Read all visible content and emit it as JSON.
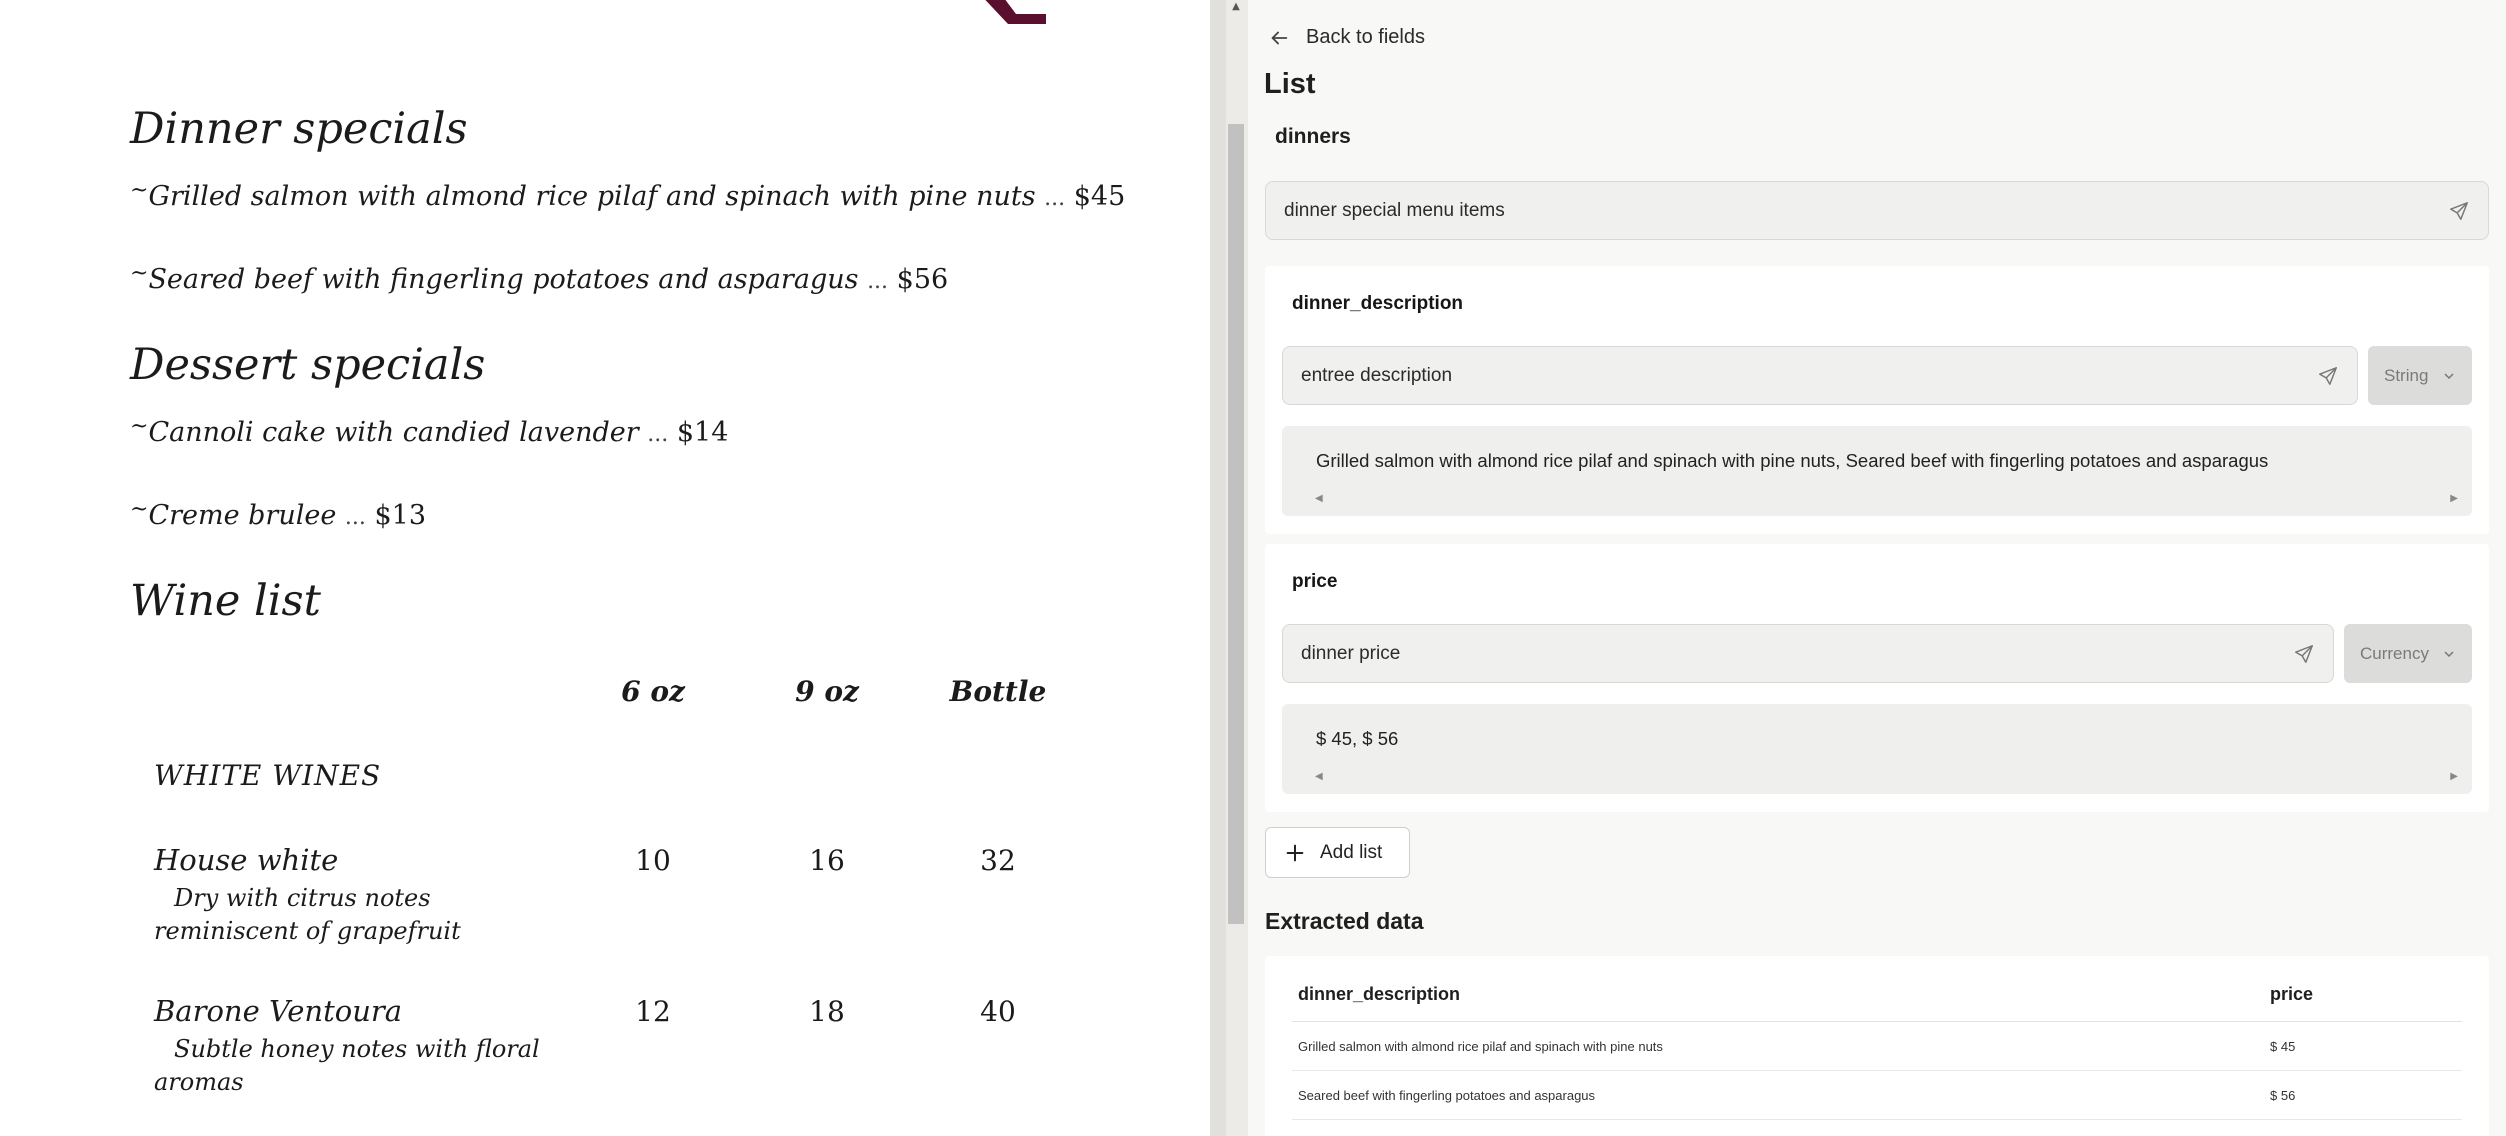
{
  "document": {
    "dinner_heading": "Dinner specials",
    "dinner_items": [
      {
        "marker": "~",
        "description": "Grilled salmon with almond rice pilaf and spinach with pine nuts",
        "dots": "...",
        "price": "$45"
      },
      {
        "marker": "~",
        "description": "Seared beef with fingerling potatoes and asparagus",
        "dots": "...",
        "price": "$56"
      }
    ],
    "dessert_heading": "Dessert specials",
    "dessert_items": [
      {
        "marker": "~",
        "description": "Cannoli cake with candied lavender",
        "dots": "...",
        "price": "$14"
      },
      {
        "marker": "~",
        "description": "Creme brulee",
        "dots": "...",
        "price": "$13"
      }
    ],
    "wine_heading": "Wine list",
    "wine_columns": [
      "6 oz",
      "9 oz",
      "Bottle"
    ],
    "wine_section": "WHITE WINES",
    "wines": [
      {
        "name": "House white",
        "note": "Dry with citrus notes reminiscent of grapefruit",
        "prices": [
          "10",
          "16",
          "32"
        ]
      },
      {
        "name": "Barone Ventoura",
        "note": "Subtle honey notes with floral aromas",
        "prices": [
          "12",
          "18",
          "40"
        ]
      }
    ],
    "brand_color": "#5a0f2e"
  },
  "panel": {
    "back_label": "Back to fields",
    "list_title": "List",
    "list_name": "dinners",
    "list_prompt": "dinner special menu items",
    "fields": [
      {
        "name": "dinner_description",
        "prompt": "entree description",
        "type": "String",
        "result": "Grilled salmon with almond rice pilaf and spinach with pine nuts, Seared beef with fingerling potatoes and asparagus"
      },
      {
        "name": "price",
        "prompt": "dinner price",
        "type": "Currency",
        "result": "$ 45, $ 56"
      }
    ],
    "add_list_label": "Add list",
    "extracted_title": "Extracted data",
    "extracted_columns": [
      "dinner_description",
      "price"
    ],
    "extracted_rows": [
      [
        "Grilled salmon with almond rice pilaf and spinach with pine nuts",
        "$ 45"
      ],
      [
        "Seared beef with fingerling potatoes and asparagus",
        "$ 56"
      ]
    ]
  }
}
